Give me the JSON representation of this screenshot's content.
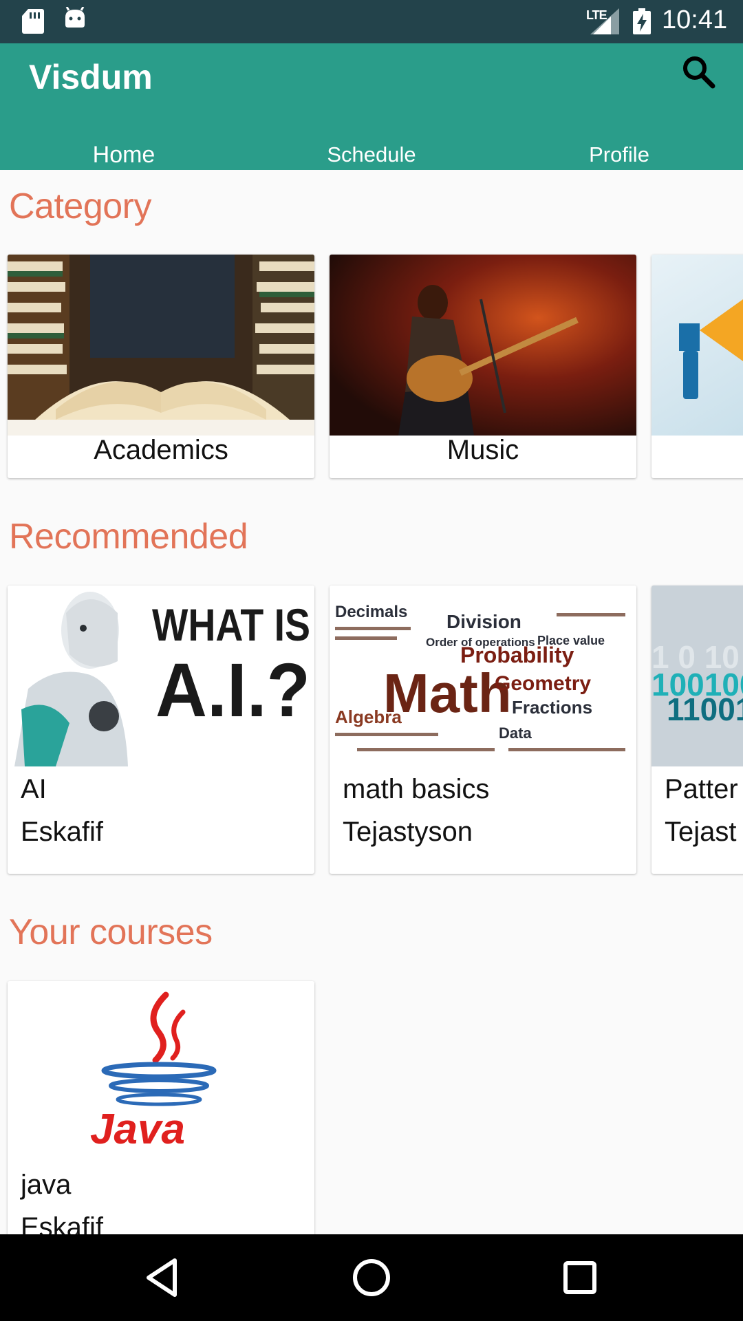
{
  "status_bar": {
    "network": "LTE",
    "time": "10:41"
  },
  "app": {
    "title": "Visdum"
  },
  "tabs": [
    {
      "label": "Home",
      "active": true
    },
    {
      "label": "Schedule",
      "active": false
    },
    {
      "label": "Profile",
      "active": false
    }
  ],
  "sections": {
    "category": {
      "title": "Category",
      "items": [
        {
          "label": "Academics"
        },
        {
          "label": "Music"
        },
        {
          "label": ""
        }
      ]
    },
    "recommended": {
      "title": "Recommended",
      "items": [
        {
          "title": "AI",
          "author": "Eskafif",
          "image_text": [
            "WHAT IS",
            "A.I.?"
          ]
        },
        {
          "title": "math basics",
          "author": "Tejastyson",
          "image_text": [
            "Decimals",
            "Division",
            "Probability",
            "Math",
            "Geometry",
            "Fractions",
            "Algebra",
            "Data",
            "Order of operations",
            "Place value"
          ]
        },
        {
          "title": "Patter",
          "author": "Tejast",
          "image_text": [
            "1 0 10",
            "100100",
            "11001"
          ]
        }
      ]
    },
    "your_courses": {
      "title": "Your courses",
      "items": [
        {
          "title": "java",
          "author": "Eskafif",
          "image_text": "Java"
        }
      ]
    }
  },
  "colors": {
    "app_bar": "#2a9d8a",
    "status_bar": "#23434b",
    "section_title": "#e27458"
  }
}
